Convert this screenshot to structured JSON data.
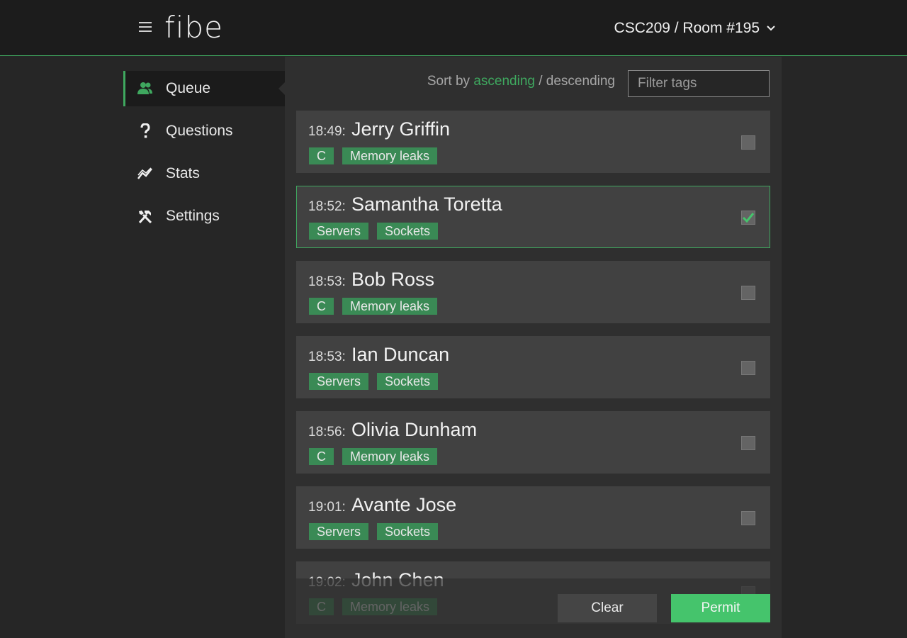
{
  "app": {
    "logo": "fibe",
    "room_selector": "CSC209 / Room #195"
  },
  "sidebar": {
    "items": [
      {
        "label": "Queue",
        "icon": "users-icon",
        "active": true
      },
      {
        "label": "Questions",
        "icon": "question-icon",
        "active": false
      },
      {
        "label": "Stats",
        "icon": "chart-line-icon",
        "active": false
      },
      {
        "label": "Settings",
        "icon": "tools-icon",
        "active": false
      }
    ]
  },
  "toolbar": {
    "sort_prefix": "Sort by",
    "ascending": "ascending",
    "separator": "/",
    "descending": "descending",
    "filter_placeholder": "Filter tags"
  },
  "queue": [
    {
      "time": "18:49:",
      "name": "Jerry Griffin",
      "tags": [
        "C",
        "Memory leaks"
      ],
      "checked": false
    },
    {
      "time": "18:52:",
      "name": "Samantha Toretta",
      "tags": [
        "Servers",
        "Sockets"
      ],
      "checked": true
    },
    {
      "time": "18:53:",
      "name": "Bob Ross",
      "tags": [
        "C",
        "Memory leaks"
      ],
      "checked": false
    },
    {
      "time": "18:53:",
      "name": "Ian Duncan",
      "tags": [
        "Servers",
        "Sockets"
      ],
      "checked": false
    },
    {
      "time": "18:56:",
      "name": "Olivia Dunham",
      "tags": [
        "C",
        "Memory leaks"
      ],
      "checked": false
    },
    {
      "time": "19:01:",
      "name": "Avante Jose",
      "tags": [
        "Servers",
        "Sockets"
      ],
      "checked": false
    },
    {
      "time": "19:02:",
      "name": "John Chen",
      "tags": [
        "C",
        "Memory leaks"
      ],
      "checked": false
    }
  ],
  "actions": {
    "clear_label": "Clear",
    "permit_label": "Permit"
  },
  "colors": {
    "accent": "#3fa85f",
    "permit": "#45c46c",
    "tag_bg": "#3a8a55"
  }
}
